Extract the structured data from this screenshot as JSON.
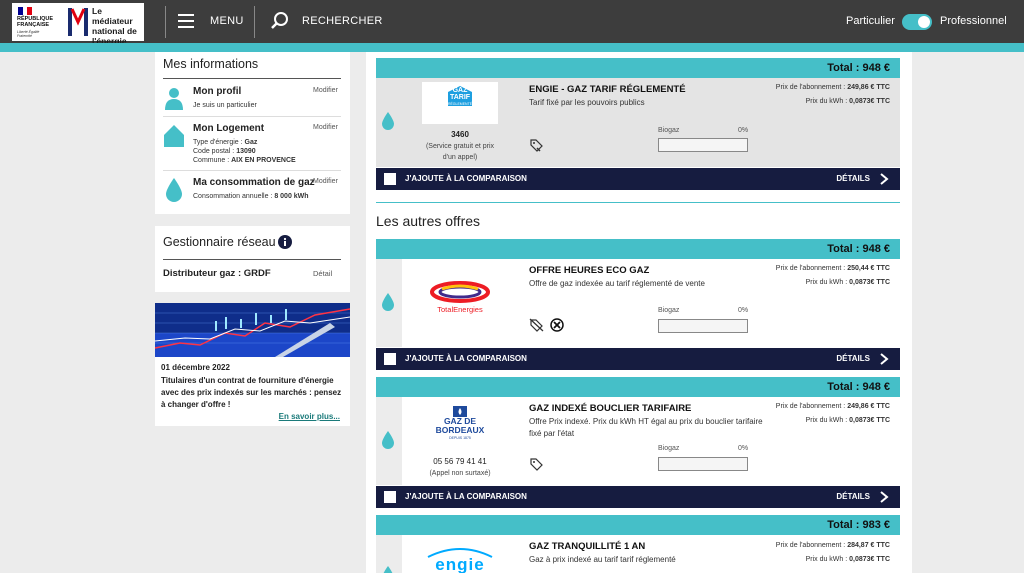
{
  "header": {
    "republic_text": "RÉPUBLIQUE FRANÇAISE",
    "republic_motto": "Liberté Égalité Fraternité",
    "mediator_text": "Le médiateur national de l'énergie",
    "menu_label": "MENU",
    "search_label": "RECHERCHER",
    "toggle_left": "Particulier",
    "toggle_right": "Professionnel"
  },
  "sidebar": {
    "info_title": "Mes informations",
    "profile": {
      "name": "Mon profil",
      "sub": "Je suis un particulier",
      "modify": "Modifier"
    },
    "logement": {
      "name": "Mon Logement",
      "modify": "Modifier",
      "energy_label": "Type d'énergie : ",
      "energy_value": "Gaz",
      "postal_label": "Code postal : ",
      "postal_value": "13090",
      "commune_label": "Commune : ",
      "commune_value": "AIX EN PROVENCE"
    },
    "consommation": {
      "name": "Ma consommation de gaz",
      "modify": "Modifier",
      "annual_label": "Consommation annuelle : ",
      "annual_value": "8 000 kWh"
    },
    "gestionnaire": {
      "title": "Gestionnaire réseau",
      "label": "Distributeur gaz : GRDF",
      "detail": "Détail"
    },
    "news": {
      "date": "01 décembre 2022",
      "text": "Titulaires d'un contrat de fourniture d'énergie avec des prix indexés sur les marchés : pensez à changer d'offre !",
      "more": "En savoir plus..."
    }
  },
  "main": {
    "section_title": "Les autres offres",
    "compare_label": "J'AJOUTE À LA COMPARAISON",
    "details_label": "DÉTAILS",
    "biogaz_label": "Biogaz",
    "offers": [
      {
        "total": "Total : 948 €",
        "title": "ENGIE - GAZ TARIF RÉGLEMENTÉ",
        "desc": "Tarif fixé par les pouvoirs publics",
        "abonnement_label": "Prix de l'abonnement : ",
        "abonnement_value": "249,86 € TTC",
        "kwh_label": "Prix du kWh : ",
        "kwh_value": "0,0873€ TTC",
        "biogaz_pct": "0%",
        "phone": "3460",
        "phone_note": "(Service gratuit et prix d'un appel)",
        "logo_line1": "GAZ",
        "logo_line2": "TARIF",
        "logo_line3": "RÉGLEMENTÉ"
      },
      {
        "total": "Total : 948 €",
        "title": "OFFRE HEURES ECO GAZ",
        "desc": "Offre de gaz indexée au tarif réglementé de vente",
        "abonnement_label": "Prix de l'abonnement : ",
        "abonnement_value": "250,44 € TTC",
        "kwh_label": "Prix du kWh : ",
        "kwh_value": "0,0873€ TTC",
        "biogaz_pct": "0%",
        "logo_text": "TotalEnergies"
      },
      {
        "total": "Total : 948 €",
        "title": "GAZ INDEXÉ BOUCLIER TARIFAIRE",
        "desc": "Offre Prix indexé. Prix du kWh HT égal au prix du bouclier tarifaire fixé par l'état",
        "abonnement_label": "Prix de l'abonnement : ",
        "abonnement_value": "249,86 € TTC",
        "kwh_label": "Prix du kWh : ",
        "kwh_value": "0,0873€ TTC",
        "biogaz_pct": "0%",
        "phone": "05 56 79 41 41",
        "phone_note": "(Appel non surtaxé)",
        "logo_line1": "GAZ DE",
        "logo_line2": "BORDEAUX",
        "logo_line3": "DEPUIS 1875"
      },
      {
        "total": "Total : 983 €",
        "title": "GAZ TRANQUILLITÉ 1 AN",
        "desc": "Gaz à prix indexé au tarif tarif réglementé",
        "abonnement_label": "Prix de l'abonnement : ",
        "abonnement_value": "284,87 € TTC",
        "kwh_label": "Prix du kWh : ",
        "kwh_value": "0,0873€ TTC",
        "logo_text": "engie"
      }
    ]
  },
  "colors": {
    "teal": "#45bfc8",
    "navy": "#161c40",
    "header": "#3d3d3d"
  }
}
